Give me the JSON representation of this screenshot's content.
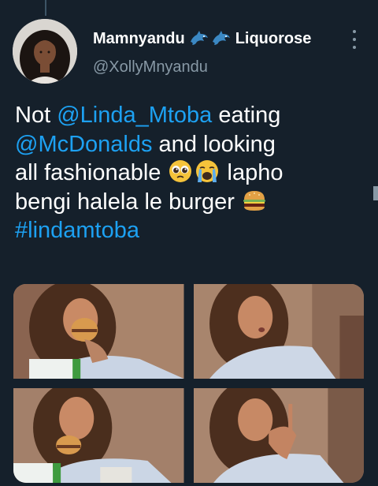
{
  "tweet": {
    "author": {
      "name_part1": "Mamnyandu",
      "name_part2": "Liquorose",
      "name_emojis": [
        "dolphin-emoji",
        "dolphin-emoji"
      ],
      "handle": "@XollyMnyandu"
    },
    "text_lines": [
      {
        "segments": [
          {
            "text": "Not ",
            "type": "text"
          },
          {
            "text": "@Linda_Mtoba",
            "type": "mention"
          },
          {
            "text": " eating",
            "type": "text"
          }
        ]
      },
      {
        "segments": [
          {
            "text": "@McDonalds",
            "type": "mention"
          },
          {
            "text": " and looking",
            "type": "text"
          }
        ]
      },
      {
        "segments": [
          {
            "text": "all fashionable ",
            "type": "text"
          },
          {
            "text": " lapho",
            "type": "text"
          }
        ]
      },
      {
        "segments": [
          {
            "text": "bengi halela le burger ",
            "type": "text"
          }
        ]
      },
      {
        "segments": [
          {
            "text": "#lindamtoba",
            "type": "hashtag"
          }
        ]
      }
    ],
    "emojis": [
      "pleading-face-emoji",
      "loudly-crying-face-emoji",
      "hamburger-emoji"
    ],
    "media": [
      {
        "name": "photo-eating-burger"
      },
      {
        "name": "photo-looking-down"
      },
      {
        "name": "photo-holding-burger"
      },
      {
        "name": "photo-licking-finger"
      }
    ]
  },
  "colors": {
    "background": "#15202b",
    "link": "#1da1f2",
    "secondary_text": "#8899a6"
  }
}
